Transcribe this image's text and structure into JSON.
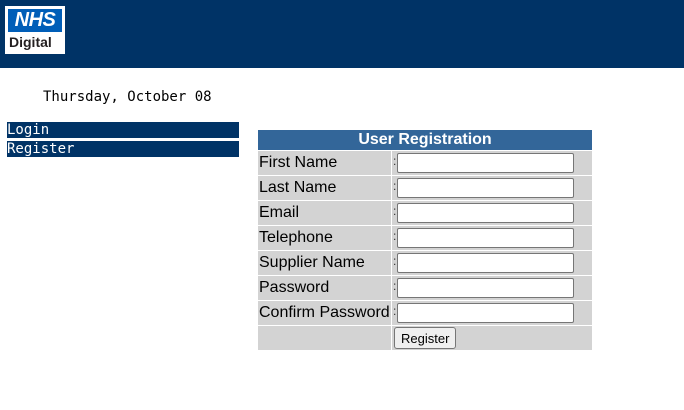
{
  "header": {
    "logo": {
      "line1": "NHS",
      "line2": "Digital"
    }
  },
  "date": "Thursday, October 08",
  "menu": {
    "items": [
      {
        "label": "Login"
      },
      {
        "label": "Register"
      }
    ]
  },
  "form": {
    "title": "User Registration",
    "fields": [
      {
        "label": "First Name",
        "value": ""
      },
      {
        "label": "Last Name",
        "value": ""
      },
      {
        "label": "Email",
        "value": ""
      },
      {
        "label": "Telephone",
        "value": ""
      },
      {
        "label": "Supplier Name",
        "value": ""
      },
      {
        "label": "Password",
        "value": ""
      },
      {
        "label": "Confirm Password",
        "value": ""
      }
    ],
    "submit_label": "Register"
  },
  "colors": {
    "header_bg": "#003366",
    "form_title_bg": "#336699",
    "cell_bg": "#d3d3d3",
    "logo_blue": "#005eb8"
  }
}
